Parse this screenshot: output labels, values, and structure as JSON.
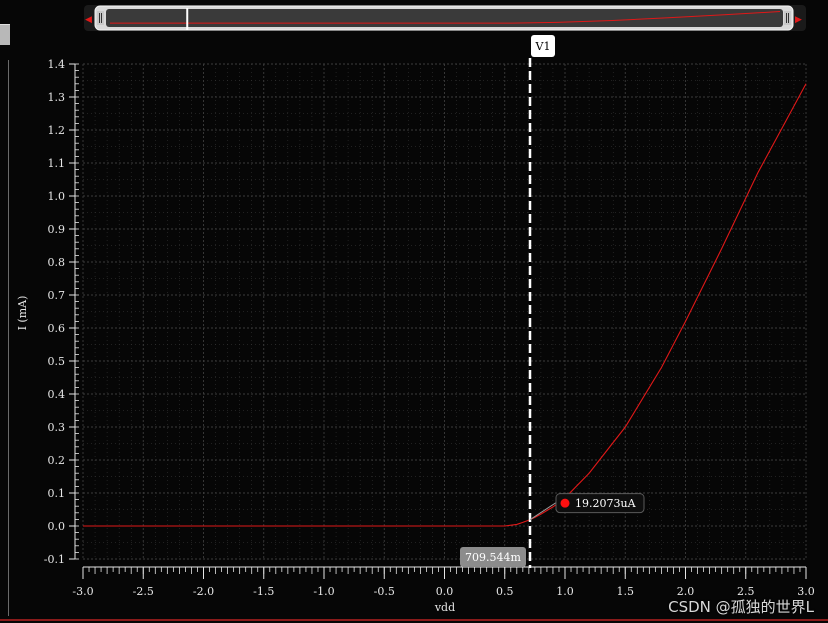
{
  "chart_data": {
    "type": "line",
    "xlabel": "vdd",
    "ylabel": "I (mA)",
    "xlim": [
      -3.0,
      3.0
    ],
    "ylim": [
      -0.1,
      1.4
    ],
    "x_ticks": [
      "-3.0",
      "-2.5",
      "-2.0",
      "-1.5",
      "-1.0",
      "-0.5",
      "0.0",
      "0.5",
      "1.0",
      "1.5",
      "2.0",
      "2.5",
      "3.0"
    ],
    "y_ticks": [
      "-0.1",
      "0.0",
      "0.1",
      "0.2",
      "0.3",
      "0.4",
      "0.5",
      "0.6",
      "0.7",
      "0.8",
      "0.9",
      "1.0",
      "1.1",
      "1.2",
      "1.3",
      "1.4"
    ],
    "grid": true,
    "series": [
      {
        "color": "#e01818",
        "x": [
          -3.0,
          -2.0,
          -1.0,
          0.0,
          0.5,
          0.6,
          0.65,
          0.7,
          0.75,
          0.8,
          0.9,
          1.0,
          1.2,
          1.5,
          1.8,
          2.0,
          2.3,
          2.6,
          3.0
        ],
        "y": [
          0.0,
          0.0,
          0.0,
          0.0,
          0.0,
          0.005,
          0.011,
          0.018,
          0.026,
          0.036,
          0.058,
          0.085,
          0.16,
          0.3,
          0.48,
          0.62,
          0.84,
          1.07,
          1.34
        ]
      }
    ],
    "cursor": {
      "name": "V1",
      "x": 0.709544,
      "x_label": "709.544m",
      "marker_y": 0.0192073,
      "marker_label": "19.2073uA",
      "marker_color": "#ff1010"
    }
  },
  "scrollbar": {
    "overview_x": [
      -3.0,
      -1.5,
      0.0,
      0.6,
      1.0,
      1.5,
      2.0,
      2.5,
      3.0
    ],
    "overview_y": [
      0.0,
      0.0,
      0.0,
      0.005,
      0.085,
      0.3,
      0.62,
      0.96,
      1.34
    ],
    "handle_fraction": 0.12
  },
  "watermark": "CSDN @孤独的世界L",
  "colors": {
    "background": "#060606",
    "axis": "#e6e6e6",
    "grid": "#3c3c3c",
    "curve": "#e01818",
    "cursor_line": "#ffffff"
  }
}
